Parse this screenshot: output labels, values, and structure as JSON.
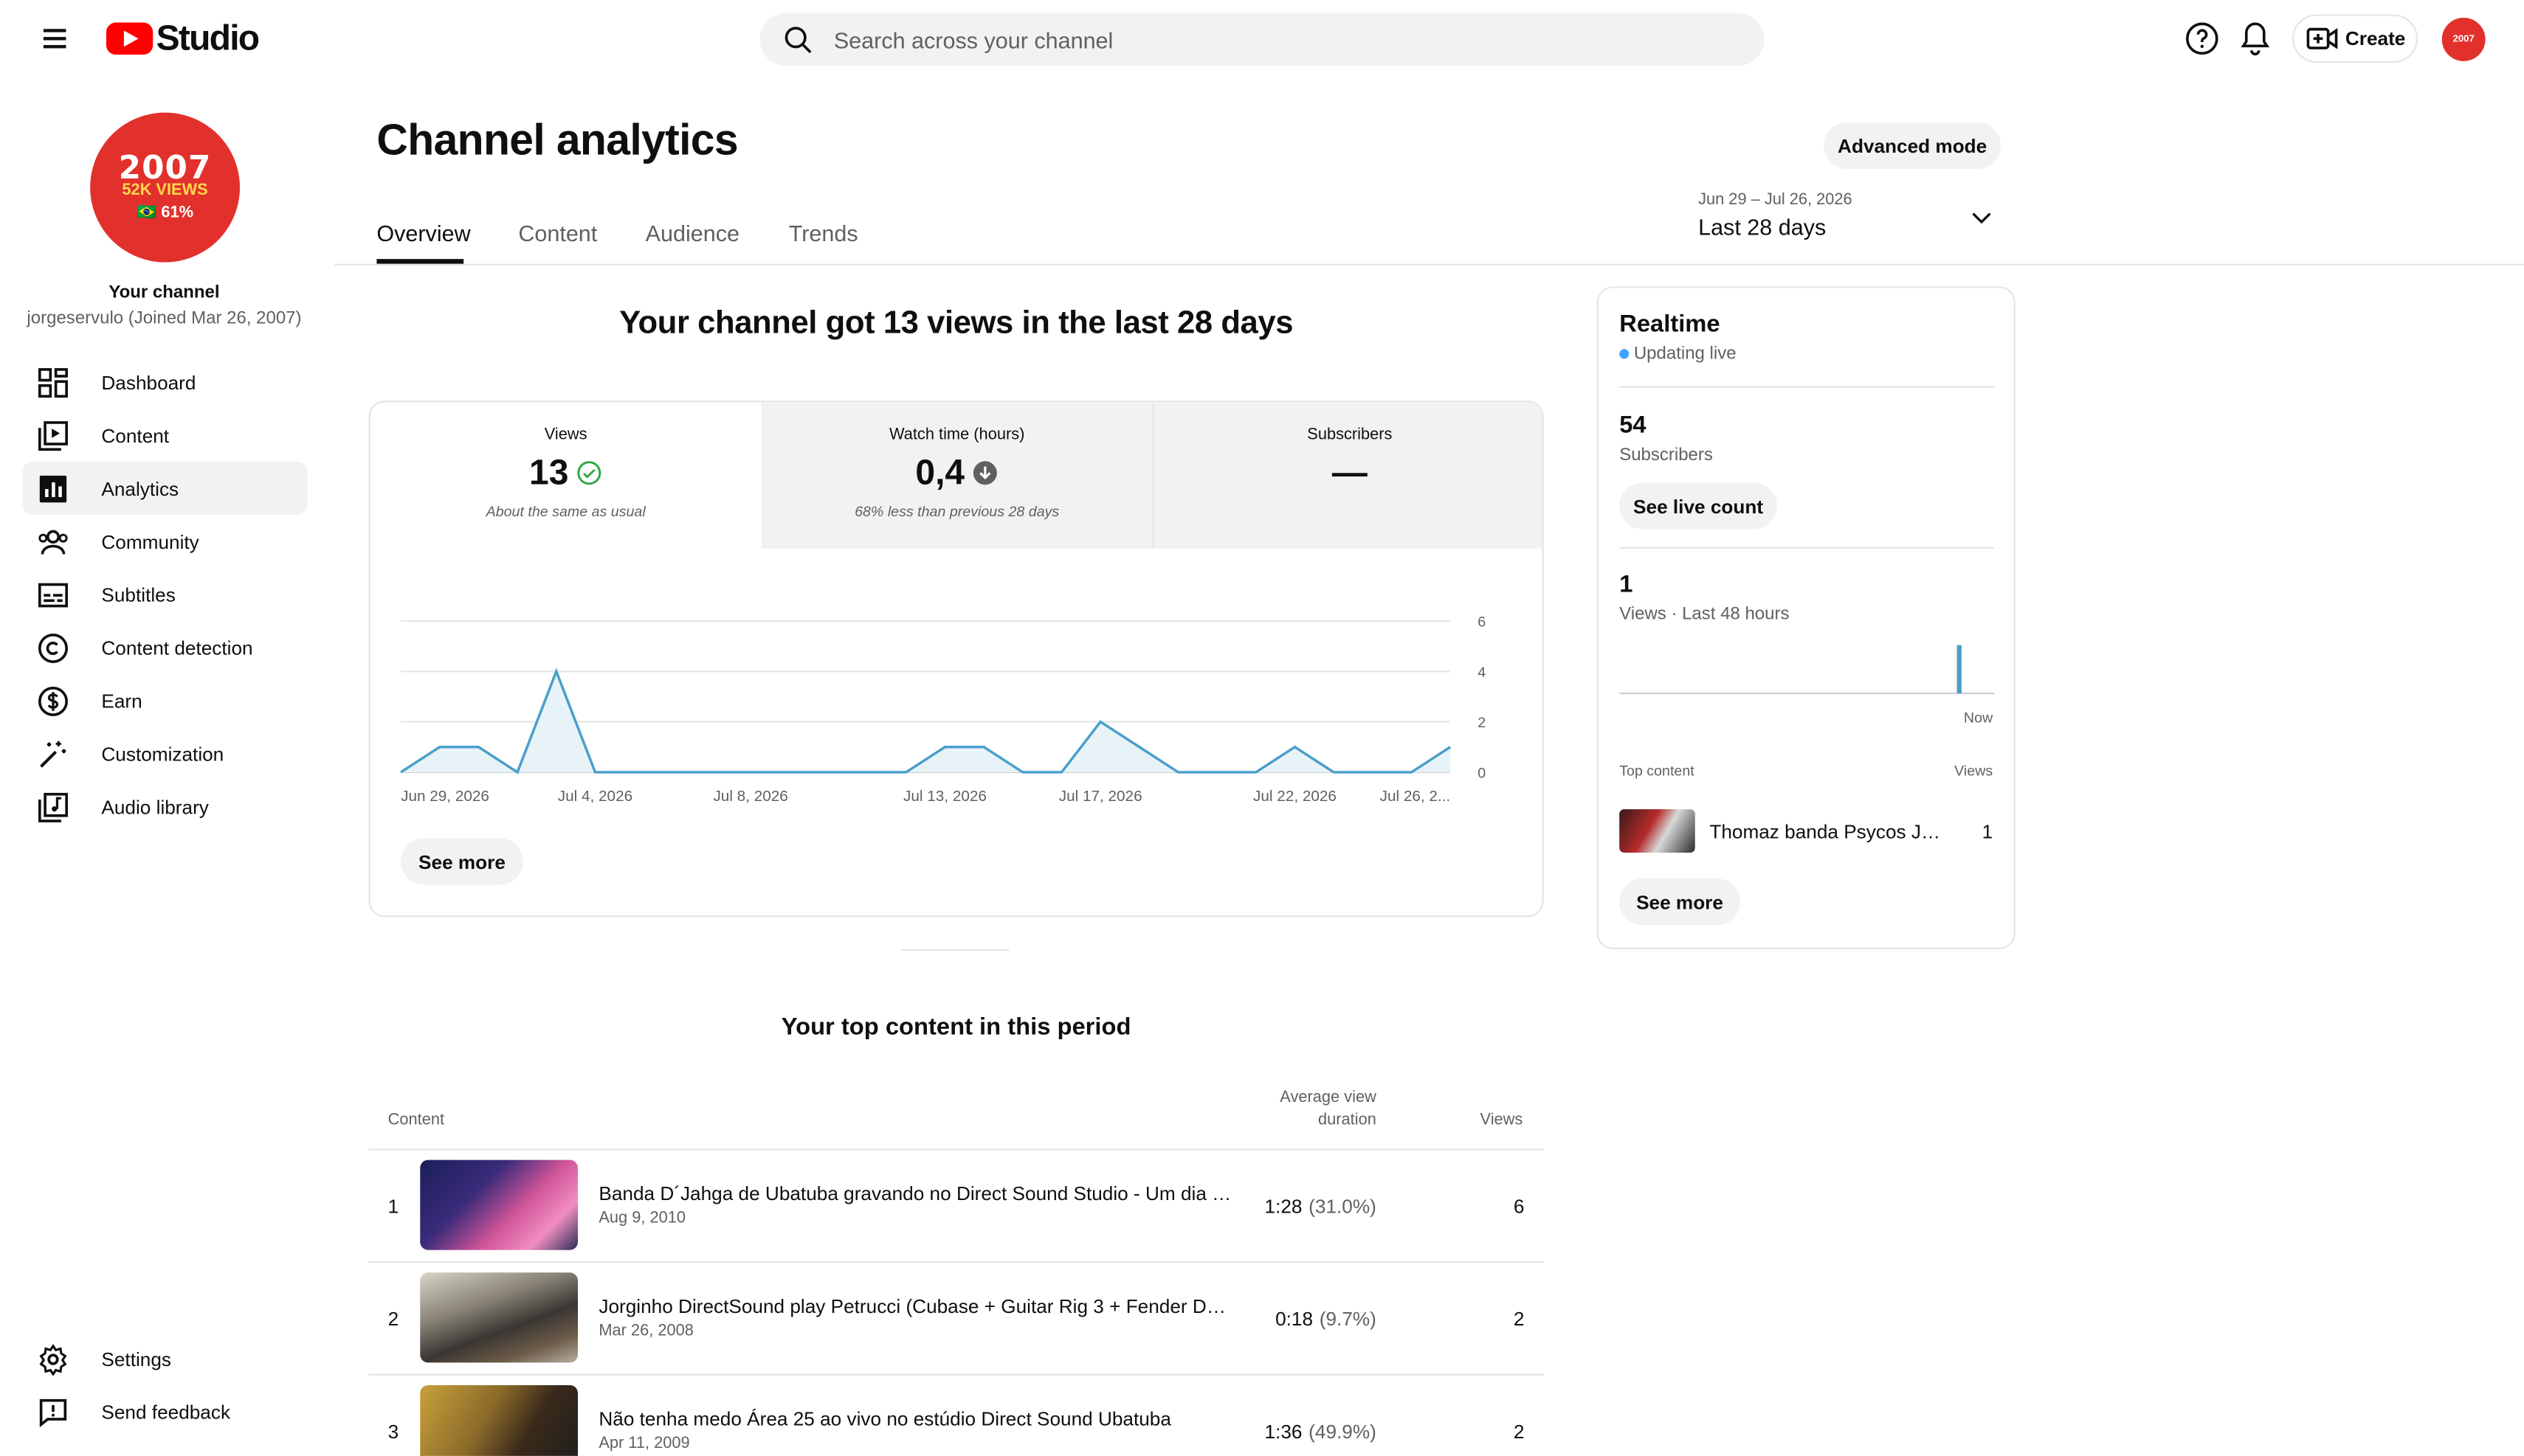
{
  "app": {
    "logo_text": "Studio"
  },
  "search": {
    "placeholder": "Search across your channel"
  },
  "header": {
    "create_label": "Create",
    "avatar_text": "2007"
  },
  "sidebar": {
    "avatar": {
      "line1": "2007",
      "line2": "52K VIEWS",
      "line3": "🇧🇷 61%"
    },
    "channel_label": "Your channel",
    "channel_handle": "jorgeservulo (Joined Mar 26, 2007)",
    "items": [
      {
        "label": "Dashboard",
        "icon": "dashboard-icon"
      },
      {
        "label": "Content",
        "icon": "content-icon"
      },
      {
        "label": "Analytics",
        "icon": "analytics-icon",
        "active": true
      },
      {
        "label": "Community",
        "icon": "community-icon"
      },
      {
        "label": "Subtitles",
        "icon": "subtitles-icon"
      },
      {
        "label": "Content detection",
        "icon": "copyright-icon"
      },
      {
        "label": "Earn",
        "icon": "dollar-icon"
      },
      {
        "label": "Customization",
        "icon": "magic-wand-icon"
      },
      {
        "label": "Audio library",
        "icon": "audio-library-icon"
      }
    ],
    "bottom_items": [
      {
        "label": "Settings",
        "icon": "gear-icon"
      },
      {
        "label": "Send feedback",
        "icon": "feedback-icon"
      }
    ]
  },
  "page": {
    "title": "Channel analytics",
    "advanced_mode_label": "Advanced mode",
    "tabs": [
      "Overview",
      "Content",
      "Audience",
      "Trends"
    ],
    "active_tab": "Overview",
    "date_range": "Jun 29 – Jul 26, 2026",
    "date_label": "Last 28 days"
  },
  "overview": {
    "headline": "Your channel got 13 views in the last 28 days",
    "metrics": [
      {
        "title": "Views",
        "value": "13",
        "status_icon": "check-circle-icon",
        "note": "About the same as usual"
      },
      {
        "title": "Watch time (hours)",
        "value": "0,4",
        "status_icon": "arrow-down-circle-icon",
        "note": "68% less than previous 28 days"
      },
      {
        "title": "Subscribers",
        "value": "—",
        "note": ""
      }
    ],
    "see_more_label": "See more"
  },
  "chart_data": {
    "type": "area",
    "series": [
      {
        "values": [
          0,
          1,
          1,
          0,
          4,
          0,
          0,
          0,
          0,
          0,
          0,
          0,
          0,
          0,
          1,
          1,
          0,
          0,
          2,
          1,
          0,
          0,
          0,
          1,
          0,
          0,
          0,
          1
        ]
      }
    ],
    "x": [
      "Jun 29",
      "Jun 30",
      "Jul 1",
      "Jul 2",
      "Jul 3",
      "Jul 4",
      "Jul 5",
      "Jul 6",
      "Jul 7",
      "Jul 8",
      "Jul 9",
      "Jul 10",
      "Jul 11",
      "Jul 12",
      "Jul 13",
      "Jul 14",
      "Jul 15",
      "Jul 16",
      "Jul 17",
      "Jul 18",
      "Jul 19",
      "Jul 20",
      "Jul 21",
      "Jul 22",
      "Jul 23",
      "Jul 24",
      "Jul 25",
      "Jul 26"
    ],
    "x_tick_labels": [
      {
        "label": "Jun 29, 2026",
        "index": 0
      },
      {
        "label": "Jul 4, 2026",
        "index": 5
      },
      {
        "label": "Jul 8, 2026",
        "index": 9
      },
      {
        "label": "Jul 13, 2026",
        "index": 14
      },
      {
        "label": "Jul 17, 2026",
        "index": 18
      },
      {
        "label": "Jul 22, 2026",
        "index": 23
      },
      {
        "label": "Jul 26, 2...",
        "index": 27
      }
    ],
    "y_ticks": [
      0,
      2,
      4,
      6
    ],
    "ylim": [
      0,
      6
    ],
    "title": "",
    "xlabel": "",
    "ylabel": "",
    "grid": true,
    "colors": {
      "line": "#4a9fca",
      "fill": "#e8f3f8"
    }
  },
  "top_content": {
    "title": "Your top content in this period",
    "col_content": "Content",
    "col_avd_1": "Average view",
    "col_avd_2": "duration",
    "col_views": "Views",
    "rows": [
      {
        "rank": "1",
        "title": "Banda D´Jahga de Ubatuba gravando no Direct Sound Studio - Um dia perfeito",
        "date": "Aug 9, 2010",
        "avd": "1:28",
        "avd_pct": "(31.0%)",
        "views": "6"
      },
      {
        "rank": "2",
        "title": "Jorginho DirectSound play Petrucci (Cubase + Guitar Rig 3 + Fender Deluxe)",
        "date": "Mar 26, 2008",
        "avd": "0:18",
        "avd_pct": "(9.7%)",
        "views": "2"
      },
      {
        "rank": "3",
        "title": "Não tenha medo Área 25 ao vivo no estúdio Direct Sound Ubatuba",
        "date": "Apr 11, 2009",
        "avd": "1:36",
        "avd_pct": "(49.9%)",
        "views": "2"
      }
    ]
  },
  "realtime": {
    "title": "Realtime",
    "status": "Updating live",
    "subscribers_value": "54",
    "subscribers_label": "Subscribers",
    "see_live_label": "See live count",
    "views_value": "1",
    "views_label": "Views · Last 48 hours",
    "views_48h": [
      0,
      0,
      0,
      0,
      0,
      0,
      0,
      0,
      0,
      0,
      0,
      0,
      0,
      0,
      0,
      0,
      0,
      0,
      0,
      0,
      0,
      0,
      0,
      0,
      0,
      0,
      0,
      0,
      0,
      0,
      0,
      0,
      0,
      0,
      0,
      0,
      0,
      0,
      0,
      0,
      0,
      0,
      0,
      1,
      0,
      0,
      0,
      0
    ],
    "now_label": "Now",
    "top_content_label": "Top content",
    "top_views_label": "Views",
    "top_item": {
      "title": "Thomaz banda Psycos Ja...",
      "views": "1"
    },
    "see_more_label": "See more"
  }
}
